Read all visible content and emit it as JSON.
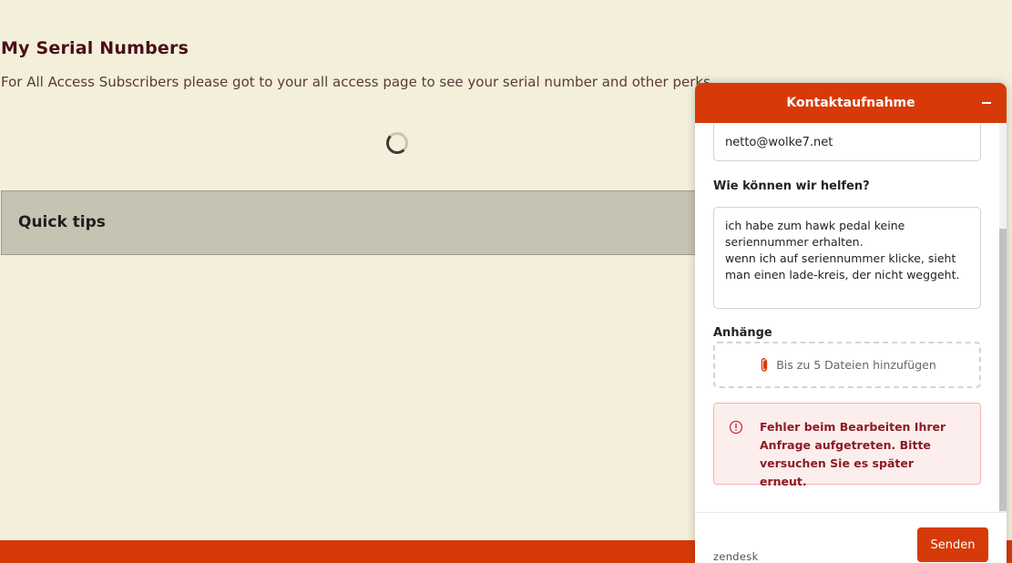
{
  "page": {
    "title": "My Serial Numbers",
    "subtitle": "For All Access Subscribers please got to your all access page to see your serial number and other perks",
    "quick_tips_label": "Quick tips"
  },
  "widget": {
    "title": "Kontaktaufnahme",
    "email_value": "netto@wolke7.net",
    "help_label": "Wie können wir helfen?",
    "help_text": "ich habe zum hawk pedal keine seriennummer erhalten.\nwenn ich auf seriennummer klicke, sieht man einen lade-kreis, der nicht weggeht.",
    "attachments_label": "Anhänge",
    "attachments_hint": "Bis zu 5 Dateien hinzufügen",
    "error_message": "Fehler beim Bearbeiten Ihrer Anfrage aufgetreten. Bitte versuchen Sie es später erneut.",
    "branding": "zendesk",
    "send_label": "Senden"
  },
  "colors": {
    "accent": "#d63a08",
    "page_background": "#f3efdb",
    "title_color": "#4a0f1a",
    "error_text": "#8a1c22",
    "error_background": "#fdeeee"
  },
  "icons": [
    "loading-spinner-icon",
    "minimize-icon",
    "paperclip-icon",
    "error-alert-icon"
  ]
}
